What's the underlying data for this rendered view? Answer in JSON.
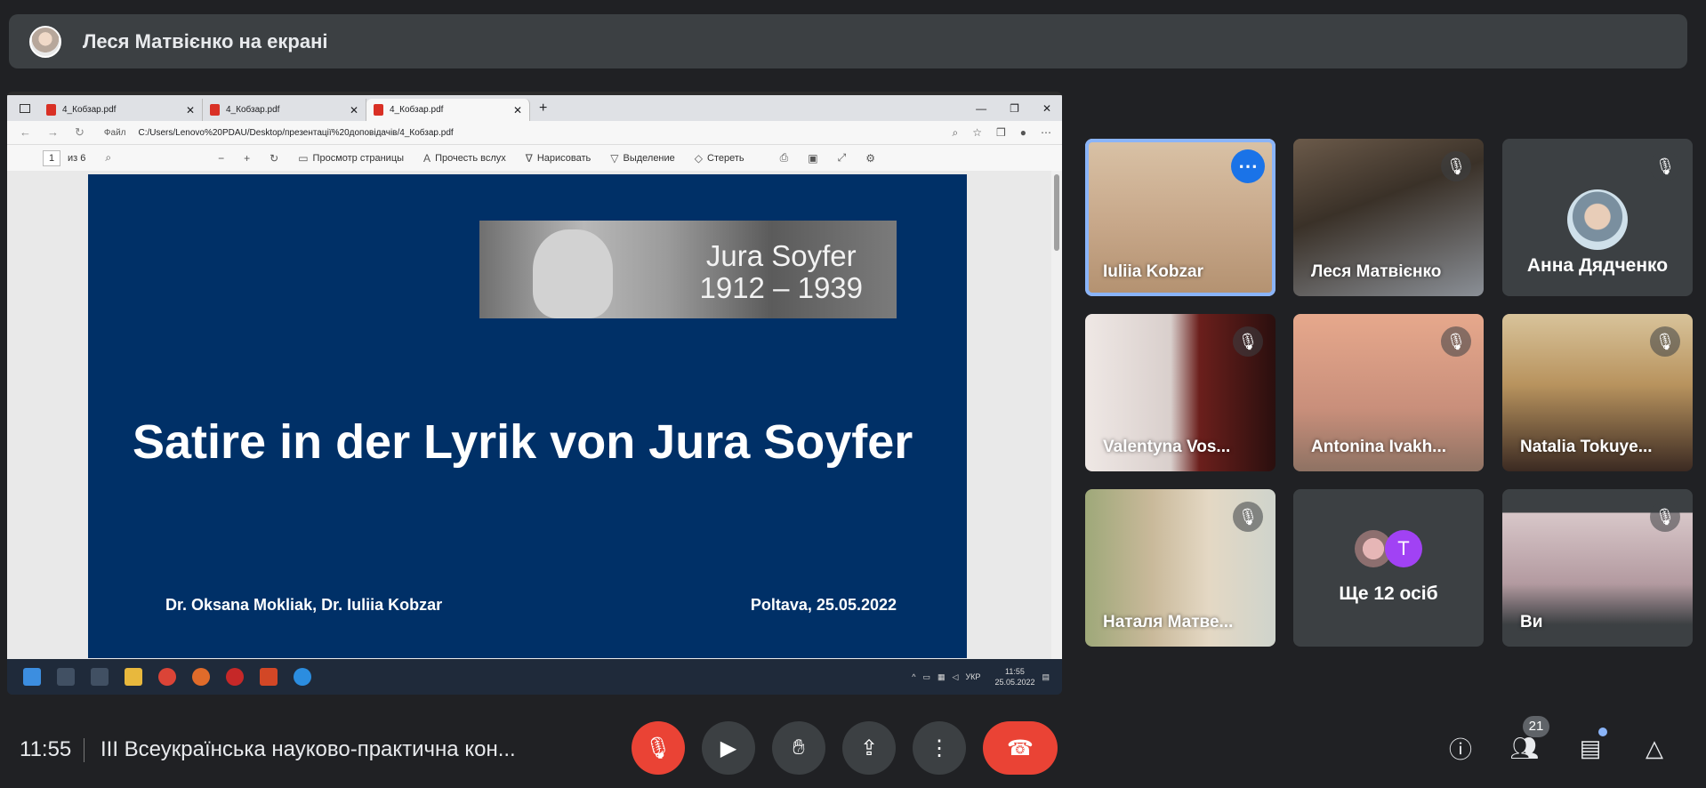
{
  "banner": {
    "presenter_text": "Леся Матвієнко на екрані"
  },
  "browser": {
    "tabs": [
      {
        "label": "4_Кобзар.pdf"
      },
      {
        "label": "4_Кобзар.pdf"
      },
      {
        "label": "4_Кобзар.pdf"
      }
    ],
    "address": {
      "file_label": "Файл",
      "url": "C:/Users/Lenovo%20PDAU/Desktop/презентації%20доповідачів/4_Кобзар.pdf"
    },
    "pdf_toolbar": {
      "page": "1",
      "of_pages": "из 6",
      "view_page": "Просмотр страницы",
      "read_aloud": "Прочесть вслух",
      "draw": "Нарисовать",
      "highlight": "Выделение",
      "erase": "Стереть"
    }
  },
  "slide": {
    "photo_name": "Jura Soyfer",
    "photo_years": "1912 – 1939",
    "title": "Satire in der Lyrik von Jura Soyfer",
    "authors": "Dr. Oksana Mokliak, Dr. Iuliia Kobzar",
    "place_date": "Poltava, 25.05.2022"
  },
  "taskbar": {
    "lang": "УКР",
    "time": "11:55",
    "date": "25.05.2022"
  },
  "participants": [
    {
      "name": "Iuliia Kobzar",
      "state": "speaking"
    },
    {
      "name": "Леся Матвієнко",
      "state": "muted"
    },
    {
      "name": "Анна Дядченко",
      "state": "muted"
    },
    {
      "name": "Valentyna Vos...",
      "state": "muted"
    },
    {
      "name": "Antonina Ivakh...",
      "state": "muted"
    },
    {
      "name": "Natalia Tokuye...",
      "state": "muted"
    },
    {
      "name": "Наталя Матве...",
      "state": "muted"
    },
    {
      "name": "Ще 12 осіб",
      "state": "more",
      "initial": "T"
    },
    {
      "name": "Ви",
      "state": "muted"
    }
  ],
  "controls": {
    "time": "11:55",
    "meeting_title": "ІІІ Всеукраїнська науково-практична кон...",
    "people_count": "21"
  },
  "colors": {
    "end_call": "#ea4335",
    "mic_off": "#ea4335",
    "accent": "#1a73e8",
    "slide_bg": "#003067"
  }
}
